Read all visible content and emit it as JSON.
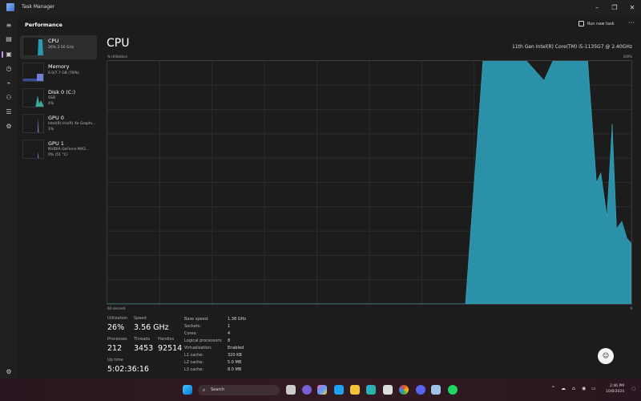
{
  "window": {
    "title": "Task Manager",
    "controls": {
      "minimize": "–",
      "restore": "❐",
      "close": "✕"
    }
  },
  "header": {
    "title": "Performance",
    "run_new_task": "Run new task",
    "more": "···"
  },
  "nav_icons": [
    "hamburger-icon",
    "processes-icon",
    "performance-icon",
    "app-history-icon",
    "startup-apps-icon",
    "users-icon",
    "details-icon",
    "services-icon",
    "settings-icon"
  ],
  "sidebar": {
    "items": [
      {
        "label": "CPU",
        "sub1": "26% 3.56 GHz",
        "sub2": "",
        "color": "#2a9bb0"
      },
      {
        "label": "Memory",
        "sub1": "6.0/7.7 GB (78%)",
        "sub2": "",
        "color": "#6f7fd6"
      },
      {
        "label": "Disk 0 (C:)",
        "sub1": "SSD",
        "sub2": "4%",
        "color": "#3aa89a"
      },
      {
        "label": "GPU 0",
        "sub1": "Intel(R) Iris(R) Xe Graphi...",
        "sub2": "1%",
        "color": "#8d7fd6"
      },
      {
        "label": "GPU 1",
        "sub1": "NVIDIA GeForce MX3...",
        "sub2": "0% (51 °C)",
        "color": "#8d7fd6"
      }
    ]
  },
  "cpu": {
    "title": "CPU",
    "model": "11th Gen Intel(R) Core(TM) i5-1135G7 @ 2.40GHz",
    "util_label": "% Utilization",
    "max_label": "100%",
    "time_label": "60 seconds",
    "min_label": "0",
    "fill_color": "#2a91a8"
  },
  "chart_data": {
    "type": "area",
    "title": "% Utilization",
    "xlabel": "60 seconds",
    "ylabel": "% Utilization",
    "ylim": [
      0,
      100
    ],
    "xlim": [
      60,
      0
    ],
    "grid": true,
    "x": [
      60,
      19,
      17,
      12,
      10,
      9,
      5,
      4,
      3.5,
      2.8,
      2.2,
      1.7,
      1.1,
      0.5,
      0
    ],
    "values": [
      0,
      0,
      100,
      100,
      92,
      100,
      100,
      50,
      54,
      36,
      74,
      31,
      34,
      27,
      25
    ]
  },
  "stats": {
    "utilization": {
      "label": "Utilization",
      "value": "26%"
    },
    "speed": {
      "label": "Speed",
      "value": "3.56 GHz"
    },
    "processes": {
      "label": "Processes",
      "value": "212"
    },
    "threads": {
      "label": "Threads",
      "value": "3453"
    },
    "handles": {
      "label": "Handles",
      "value": "92514"
    },
    "uptime": {
      "label": "Up time",
      "value": "5:02:36:16"
    }
  },
  "details": [
    {
      "key": "Base speed:",
      "value": "1.38 GHz"
    },
    {
      "key": "Sockets:",
      "value": "1"
    },
    {
      "key": "Cores:",
      "value": "4"
    },
    {
      "key": "Logical processors:",
      "value": "8"
    },
    {
      "key": "Virtualization:",
      "value": "Enabled"
    },
    {
      "key": "L1 cache:",
      "value": "320 KB"
    },
    {
      "key": "L2 cache:",
      "value": "5.0 MB"
    },
    {
      "key": "L3 cache:",
      "value": "8.0 MB"
    }
  ],
  "taskbar": {
    "search_placeholder": "Search",
    "apps": [
      "task-view",
      "teams",
      "copilot",
      "skype",
      "file-explorer",
      "edge",
      "store",
      "chrome",
      "discord",
      "task-manager",
      "spotify"
    ],
    "time": "2:46 PM",
    "date": "10/8/2024",
    "tray": [
      "^",
      "☁",
      "⌂",
      "◉",
      "▭"
    ]
  }
}
